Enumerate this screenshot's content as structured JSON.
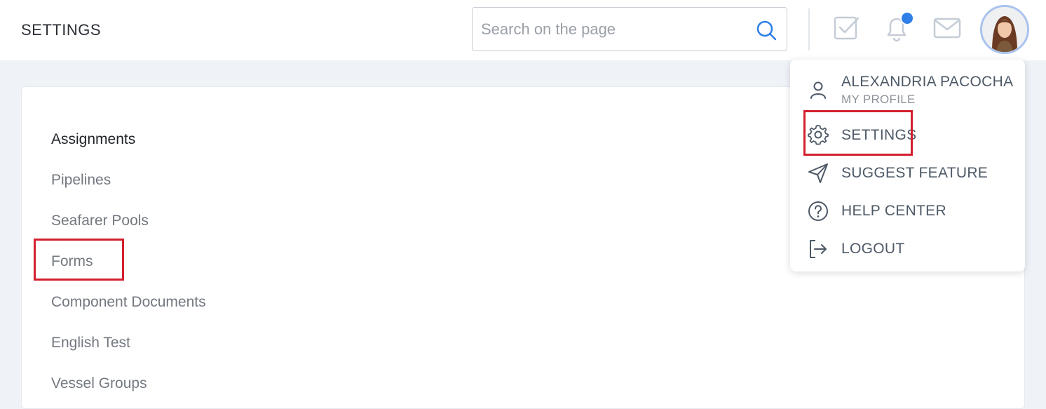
{
  "header": {
    "title": "SETTINGS",
    "search": {
      "placeholder": "Search on the page",
      "value": ""
    },
    "icons": [
      "checklist-icon",
      "bell-icon",
      "mail-icon"
    ],
    "notification_dot_color": "#2f7fe6"
  },
  "settings_nav": {
    "items": [
      {
        "label": "Assignments",
        "active": true
      },
      {
        "label": "Pipelines",
        "active": false
      },
      {
        "label": "Seafarer Pools",
        "active": false
      },
      {
        "label": "Forms",
        "active": false,
        "highlighted": true
      },
      {
        "label": "Component Documents",
        "active": false
      },
      {
        "label": "English Test",
        "active": false
      },
      {
        "label": "Vessel Groups",
        "active": false
      }
    ]
  },
  "user_menu": {
    "user_name": "ALEXANDRIA PACOCHA",
    "profile_label": "MY PROFILE",
    "items": [
      {
        "label": "SETTINGS",
        "icon": "gear-icon",
        "highlighted": true
      },
      {
        "label": "SUGGEST FEATURE",
        "icon": "paper-plane-icon"
      },
      {
        "label": "HELP CENTER",
        "icon": "question-circle-icon"
      },
      {
        "label": "LOGOUT",
        "icon": "logout-icon"
      }
    ]
  },
  "colors": {
    "highlight_box": "#d3202e",
    "accent_blue": "#2f7fe6"
  }
}
